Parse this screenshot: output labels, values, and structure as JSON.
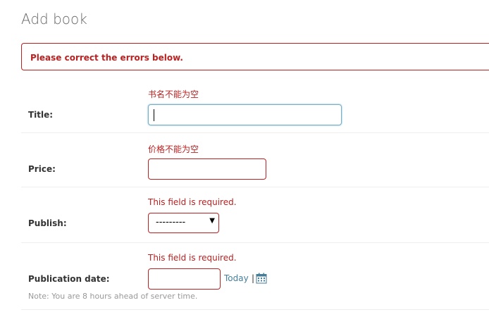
{
  "page": {
    "title": "Add book"
  },
  "errornote": "Please correct the errors below.",
  "fields": {
    "title": {
      "label": "Title:",
      "error": "书名不能为空",
      "value": ""
    },
    "price": {
      "label": "Price:",
      "error": "价格不能为空",
      "value": ""
    },
    "publish": {
      "label": "Publish:",
      "error": "This field is required.",
      "selected": "---------"
    },
    "publication_date": {
      "label": "Publication date:",
      "error": "This field is required.",
      "value": "",
      "today": "Today",
      "separator": "|",
      "help": "Note: You are 8 hours ahead of server time."
    }
  },
  "icons": {
    "calendar": "calendar-icon",
    "select_arrow": "chevron-down-icon"
  },
  "colors": {
    "error": "#ba2121",
    "focus": "#79aec8",
    "link": "#447e9b",
    "help": "#999999"
  }
}
